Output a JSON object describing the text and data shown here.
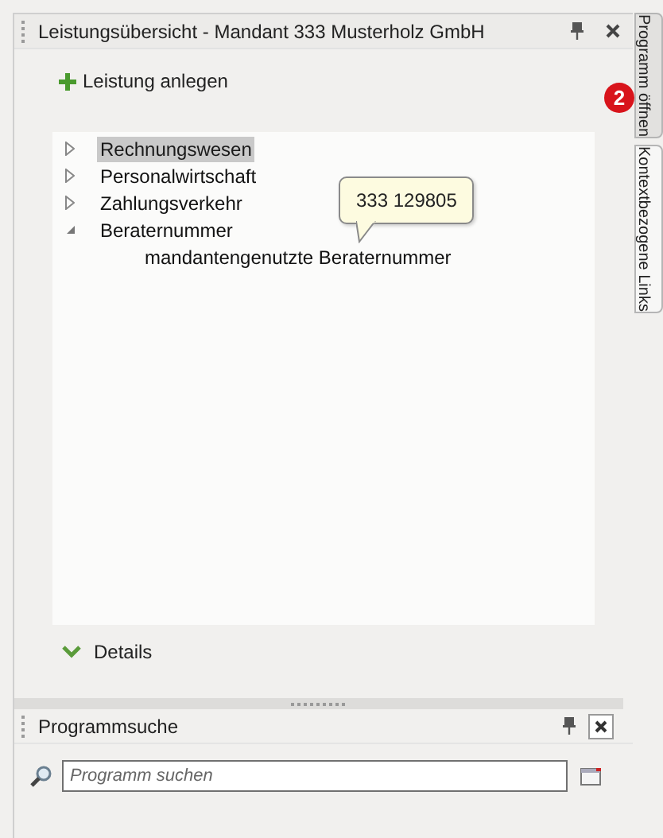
{
  "panel": {
    "title": "Leistungsübersicht - Mandant 333 Musterholz GmbH"
  },
  "toolbar": {
    "add_label": "Leistung anlegen"
  },
  "tree": [
    {
      "label": "Rechnungswesen",
      "expanded": false,
      "selected": true
    },
    {
      "label": "Personalwirtschaft",
      "expanded": false,
      "selected": false
    },
    {
      "label": "Zahlungsverkehr",
      "expanded": false,
      "selected": false
    },
    {
      "label": "Beraternummer",
      "expanded": true,
      "selected": false,
      "children": [
        {
          "label": "mandantengenutzte Beraternummer",
          "selected": false
        }
      ]
    }
  ],
  "tooltip": {
    "text": "333 129805"
  },
  "details": {
    "label": "Details",
    "expanded": true
  },
  "search_panel": {
    "title": "Programmsuche",
    "placeholder": "Programm suchen"
  },
  "side_tabs": [
    {
      "label": "Programm öffnen",
      "selected": true
    },
    {
      "label": "Kontextbezogene Links",
      "selected": false
    }
  ],
  "badge": {
    "text": "2"
  }
}
